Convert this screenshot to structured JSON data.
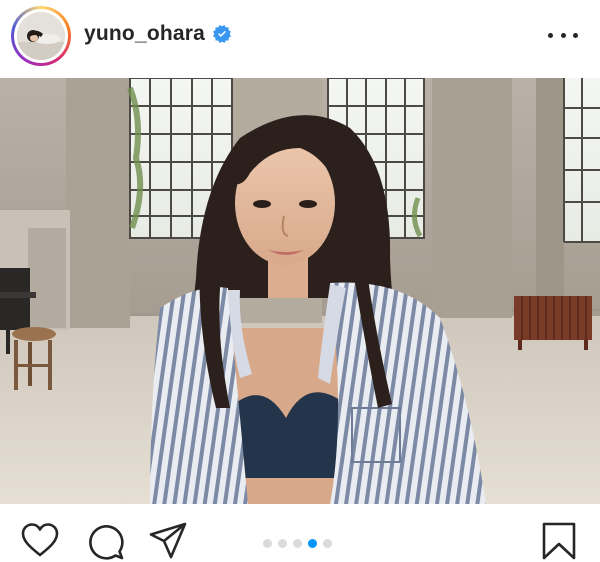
{
  "header": {
    "username": "yuno_ohara",
    "verified": true,
    "avatar_icon": "profile-avatar",
    "more_icon": "more-options-icon"
  },
  "photo": {
    "description_icon": "post-photo"
  },
  "actions": {
    "like_icon": "heart-icon",
    "comment_icon": "comment-icon",
    "share_icon": "paper-plane-icon",
    "save_icon": "bookmark-icon"
  },
  "carousel": {
    "total": 5,
    "active_index": 3
  },
  "colors": {
    "text": "#262626",
    "verified_blue": "#3897f0",
    "active_dot": "#0095f6",
    "inactive_dot": "#dbdbdb"
  }
}
